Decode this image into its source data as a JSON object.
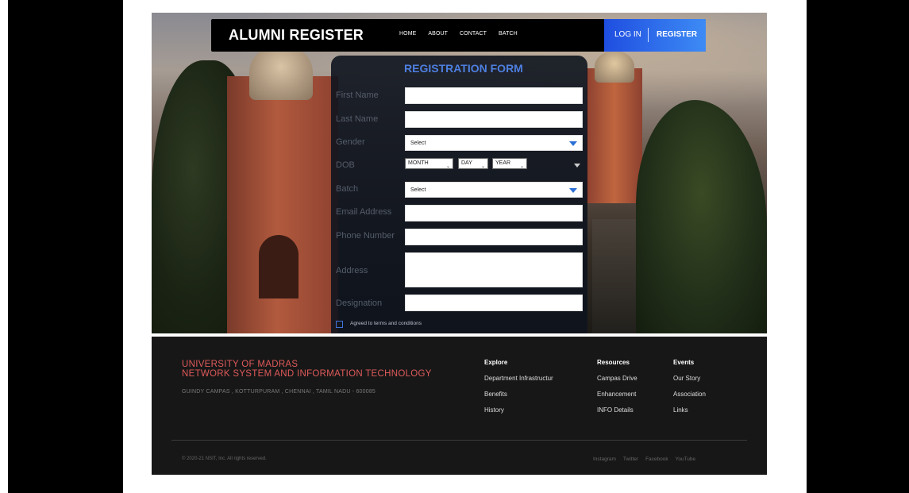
{
  "navbar": {
    "brand": "ALUMNI REGISTER",
    "links": [
      "HOME",
      "ABOUT",
      "CONTACT",
      "BATCH"
    ],
    "login": "LOG IN",
    "register": "REGISTER"
  },
  "form": {
    "title": "REGISTRATION FORM",
    "labels": {
      "first_name": "First Name",
      "last_name": "Last Name",
      "gender": "Gender",
      "dob": "DOB",
      "batch": "Batch",
      "email": "Email Address",
      "phone": "Phone Number",
      "address": "Address",
      "designation": "Designation"
    },
    "gender_selected": "Select",
    "batch_selected": "Select",
    "dob": {
      "month": "MONTH",
      "day": "DAY",
      "year": "YEAR"
    },
    "terms": "Agreed to terms and conditions"
  },
  "footer": {
    "university": "UNIVERSITY OF MADRAS",
    "department": "NETWORK SYSTEM AND INFORMATION TECHNOLOGY",
    "address": "GUINDY CAMPAS , KOTTURPURAM , CHENNAI , TAMIL NADU - 600085",
    "columns": [
      {
        "title": "Explore",
        "items": [
          "Department Infrastructur",
          "Benefits",
          "History"
        ]
      },
      {
        "title": "Resources",
        "items": [
          "Campas Drive",
          "Enhancement",
          "INFO Details"
        ]
      },
      {
        "title": "Events",
        "items": [
          "Our Story",
          "Association",
          "Links"
        ]
      }
    ],
    "copyright": "© 2020-21 NSIT, Inc. All rights reserved.",
    "social": [
      "Instagram",
      "Twitter",
      "Facebook",
      "YouTube"
    ]
  },
  "colors": {
    "accent": "#3d8bf5",
    "footer_title": "#e05a5a",
    "footer_bg": "#171717"
  }
}
